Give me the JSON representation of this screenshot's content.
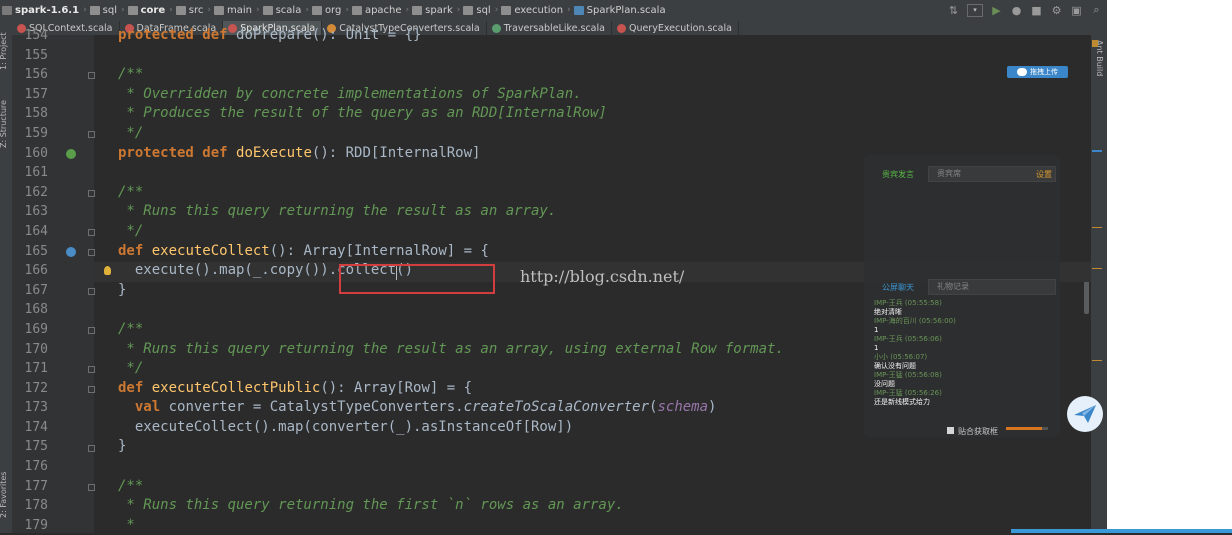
{
  "breadcrumb": [
    "spark-1.6.1",
    "sql",
    "core",
    "src",
    "main",
    "scala",
    "org",
    "apache",
    "spark",
    "sql",
    "execution",
    "SparkPlan.scala"
  ],
  "tabs": [
    {
      "label": "SQLContext.scala",
      "active": false
    },
    {
      "label": "DataFrame.scala",
      "active": false
    },
    {
      "label": "SparkPlan.scala",
      "active": true
    },
    {
      "label": "CatalystTypeConverters.scala",
      "active": false
    },
    {
      "label": "TraversableLike.scala",
      "active": false
    },
    {
      "label": "QueryExecution.scala",
      "active": false
    }
  ],
  "tool_windows": {
    "project": "1: Project",
    "structure": "Z: Structure",
    "favorites": "2: Favorites",
    "ant_build": "Ant Build"
  },
  "line_numbers": [
    "154",
    "155",
    "156",
    "157",
    "158",
    "159",
    "160",
    "161",
    "162",
    "163",
    "164",
    "165",
    "166",
    "167",
    "168",
    "169",
    "170",
    "171",
    "172",
    "173",
    "174",
    "175",
    "176",
    "177",
    "178",
    "179"
  ],
  "code": {
    "l154_kw1": "protected",
    "l154_kw2": "def",
    "l154_rest": " doPrepare(): Unit = {}",
    "l156": "/**",
    "l157": " * Overridden by concrete implementations of SparkPlan.",
    "l158": " * Produces the result of the query as an RDD[InternalRow]",
    "l159": " */",
    "l160_kw1": "protected",
    "l160_kw2": "def",
    "l160_fn": "doExecute",
    "l160_rest": "(): RDD[InternalRow]",
    "l162": "/**",
    "l163": " * Runs this query returning the result as an array.",
    "l164": " */",
    "l165_kw": "def",
    "l165_fn": "executeCollect",
    "l165_rest": "(): Array[InternalRow] = {",
    "l166": "  execute().map(_.copy()).collect()",
    "l167": "}",
    "l169": "/**",
    "l170": " * Runs this query returning the result as an array, using external Row format.",
    "l171": " */",
    "l172_kw": "def",
    "l172_fn": "executeCollectPublic",
    "l172_rest": "(): Array[Row] = {",
    "l173_kw": "  val",
    "l173_a": " converter = CatalystTypeConverters.",
    "l173_it": "createToScalaConverter",
    "l173_b": "(",
    "l173_pur": "schema",
    "l173_c": ")",
    "l174": "  executeCollect().map(converter(_).asInstanceOf[Row])",
    "l175": "}",
    "l177": "/**",
    "l178": " * Runs this query returning the first `n` rows as an array.",
    "l179": " *"
  },
  "watermark": "http://blog.csdn.net/",
  "chat": {
    "tab_guest": "贵宾发言",
    "input_guest": "贵宾席",
    "settings": "设置",
    "tab_public": "公屏聊天",
    "tab_gifts": "礼物记录",
    "messages": [
      {
        "header": "IMP-王兵 (05:55:58)",
        "text": "绝对清晰"
      },
      {
        "header": "IMP-海的百川 (05:56:00)",
        "text": "1"
      },
      {
        "header": "IMP-王兵 (05:56:06)",
        "text": "1"
      },
      {
        "header": "小小 (05:56:07)",
        "text": "确认没有问题"
      },
      {
        "header": "IMP-王猛 (05:56:08)",
        "text": "没问题"
      },
      {
        "header": "IMP-王猛 (05:56:26)",
        "text": "还是新线模式给力"
      }
    ],
    "checkbox_label": "贴合获取框",
    "slider_level": 0.85
  },
  "upload_button": "拖拽上传",
  "colors": {
    "keyword": "#cc7832",
    "doc": "#629755",
    "function": "#ffc66d",
    "text": "#a9b7c6",
    "annotation": "#d23d3d"
  },
  "icons": [
    "run-icon",
    "debug-icon",
    "stop-icon",
    "settings-icon",
    "sdk-icon",
    "search-icon"
  ]
}
